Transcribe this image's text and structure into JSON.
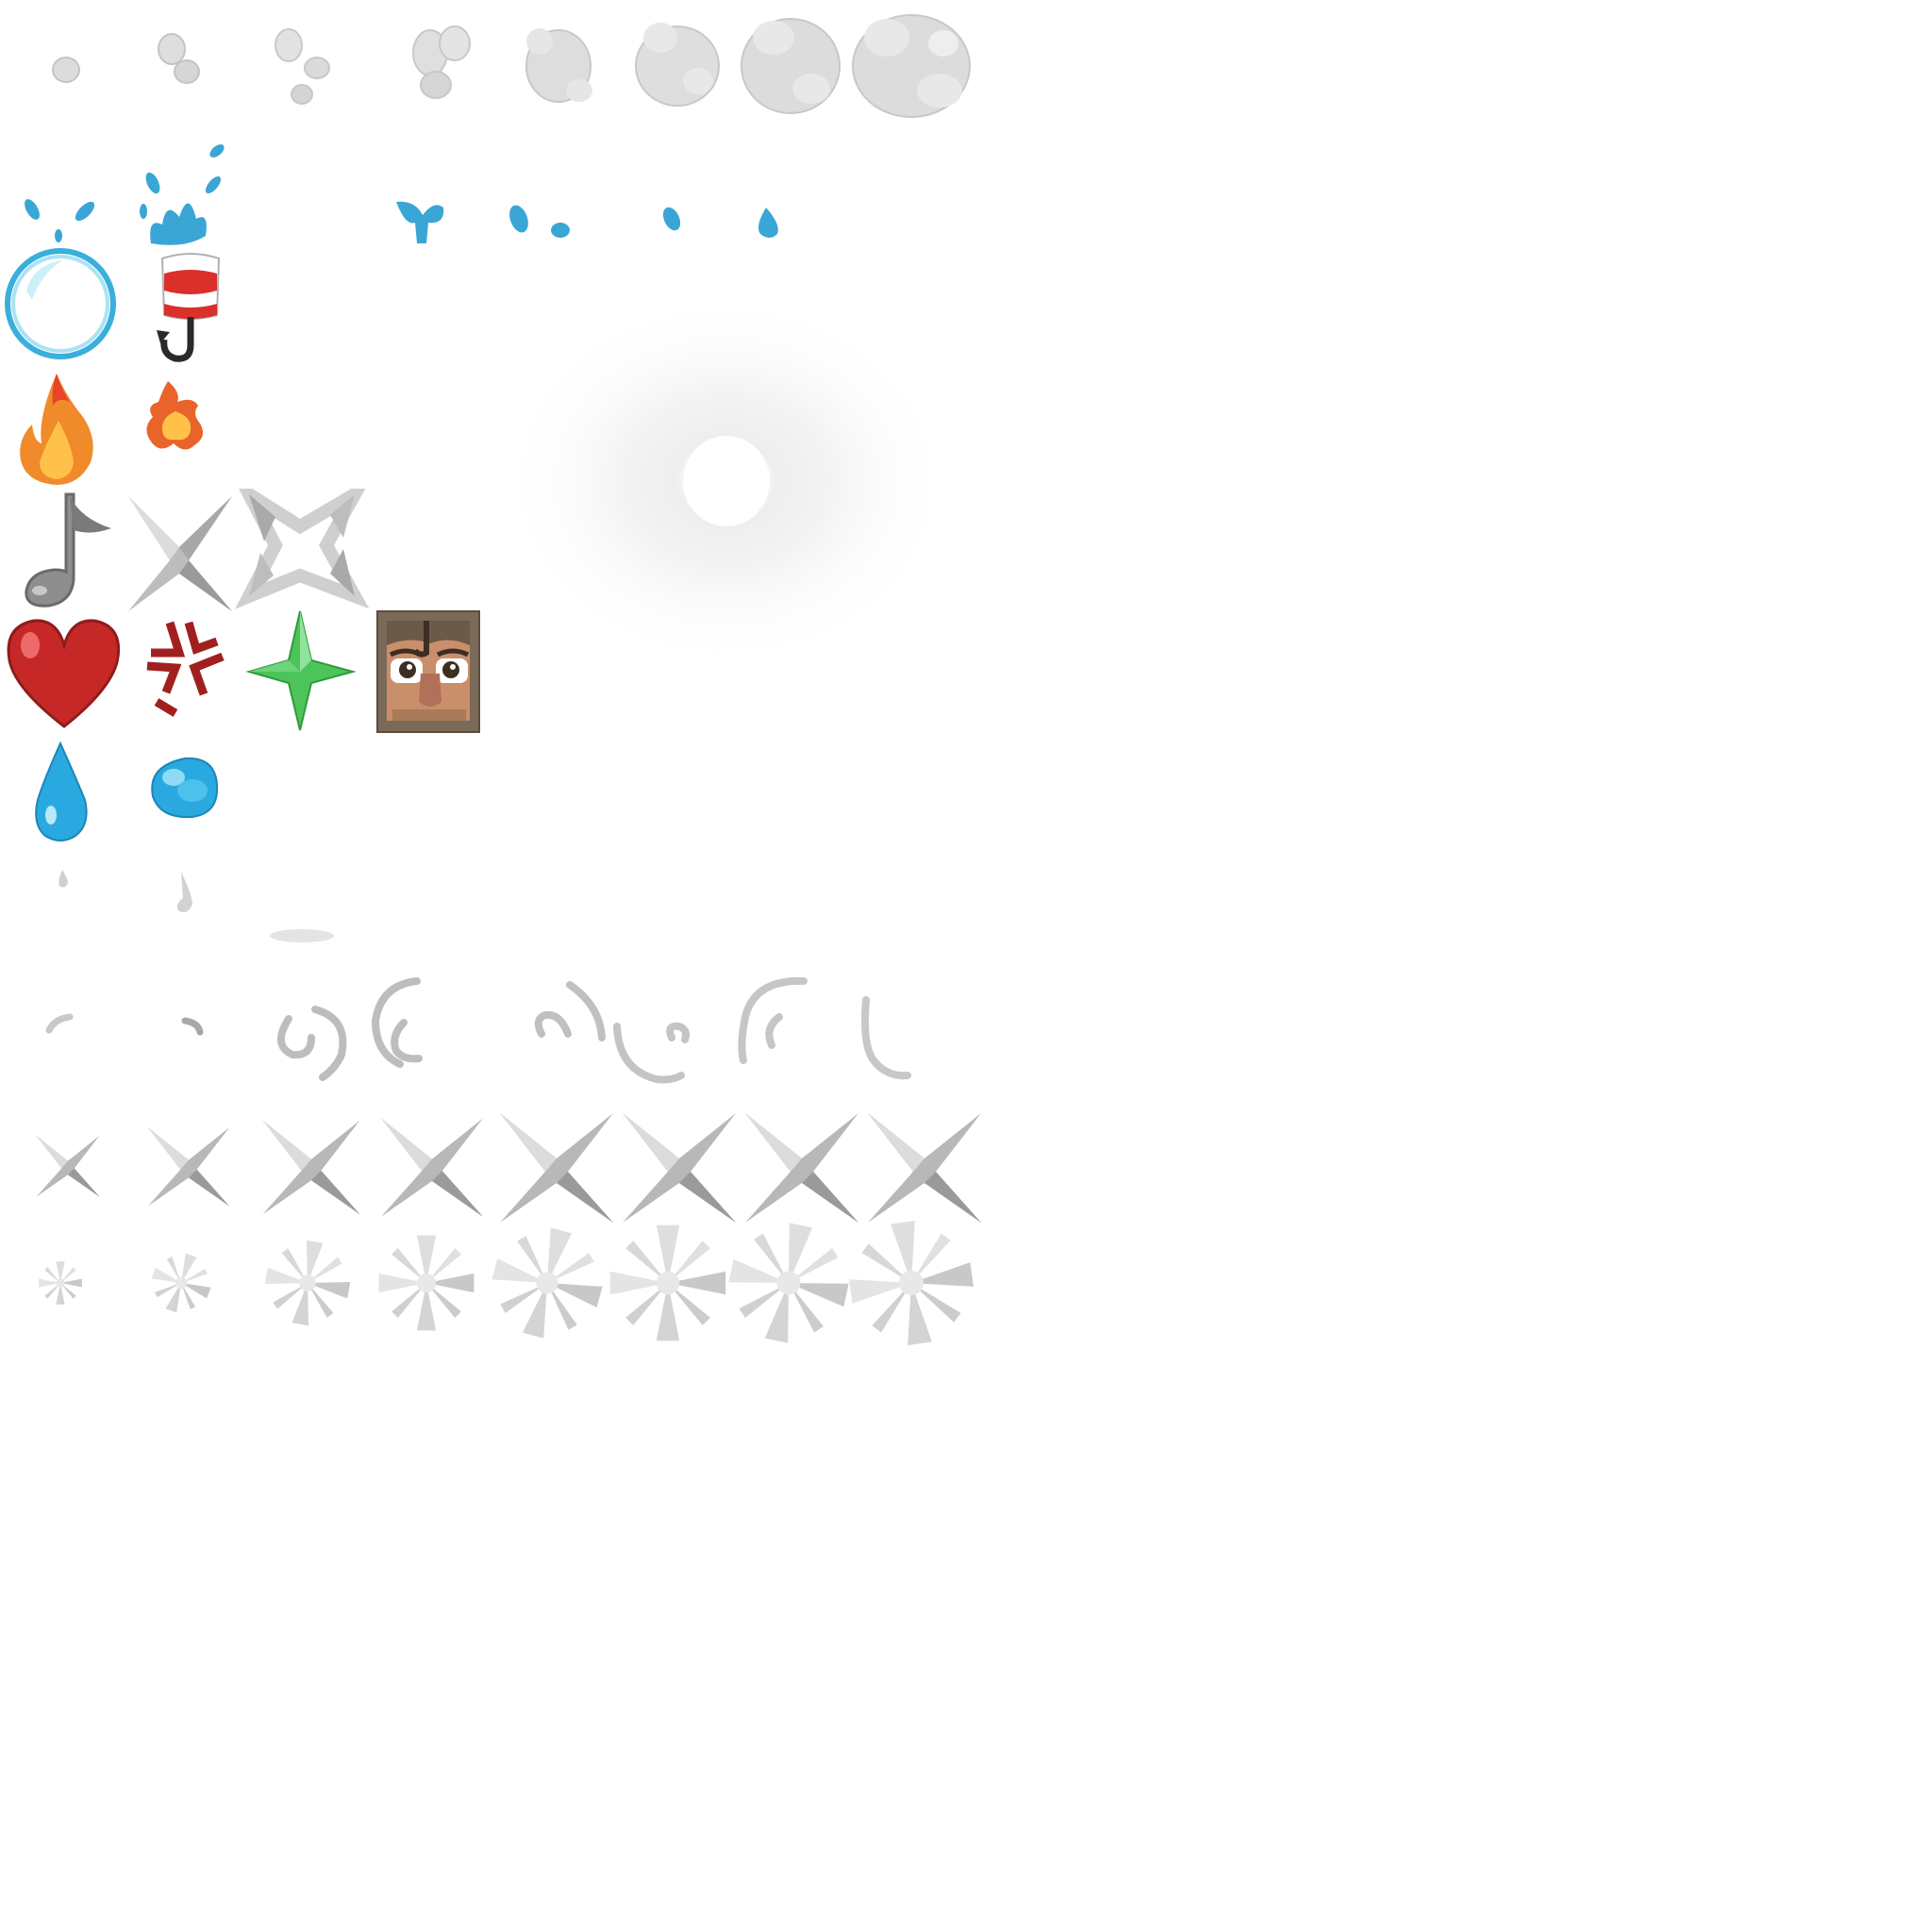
{
  "sheet": {
    "background": "#ffffff",
    "grid_columns": 16,
    "grid_rows": 16
  },
  "rows": [
    {
      "name": "smoke-puff-frames",
      "frame_count": 8,
      "icon": "smoke-icon",
      "color": "#e0e0e0"
    },
    {
      "name": "water-splash-frames",
      "frame_count": 7,
      "icon": "splash-icon",
      "color": "#3aa6d6"
    },
    {
      "name": "bubble-and-bobber",
      "icons": [
        "bubble-icon",
        "fishing-bobber-icon"
      ],
      "colors": [
        "#3aaedc",
        "#d9302c"
      ]
    },
    {
      "name": "flame-sprites",
      "icons": [
        "flame-icon",
        "small-flame-icon"
      ],
      "color": "#f08a2a"
    },
    {
      "name": "note-and-crit-sprites",
      "icons": [
        "music-note-icon",
        "crit-star-icon",
        "outlined-crit-star-icon"
      ],
      "color": "#8e8e8e"
    },
    {
      "name": "emote-sprites",
      "icons": [
        "heart-icon",
        "angry-vein-icon",
        "green-sparkle-icon",
        "villager-face-icon"
      ],
      "colors": [
        "#c62828",
        "#a02020",
        "#4cc45a",
        "#7a6a58"
      ]
    },
    {
      "name": "drip-sprites",
      "icons": [
        "water-drop-icon",
        "water-blob-icon"
      ],
      "color": "#29a9e0"
    },
    {
      "name": "small-particle-sprites",
      "icons": [
        "tiny-drop-icon",
        "small-drop-icon",
        "flat-ellipse-icon"
      ],
      "color": "#d8d8d8"
    },
    {
      "name": "sweep-arc-frames",
      "frame_count": 8,
      "icon": "sweep-arc-icon",
      "color": "#bdbdbd"
    },
    {
      "name": "crit-star-frames",
      "frame_count": 8,
      "icon": "crit-star-icon",
      "color": "#a9a9a9"
    },
    {
      "name": "burst-star-frames",
      "frame_count": 8,
      "icon": "burst-icon",
      "color": "#dddddd"
    }
  ],
  "glow": {
    "name": "soft-glow-sprite",
    "icon": "glow-icon",
    "color": "#f2f2f2"
  }
}
